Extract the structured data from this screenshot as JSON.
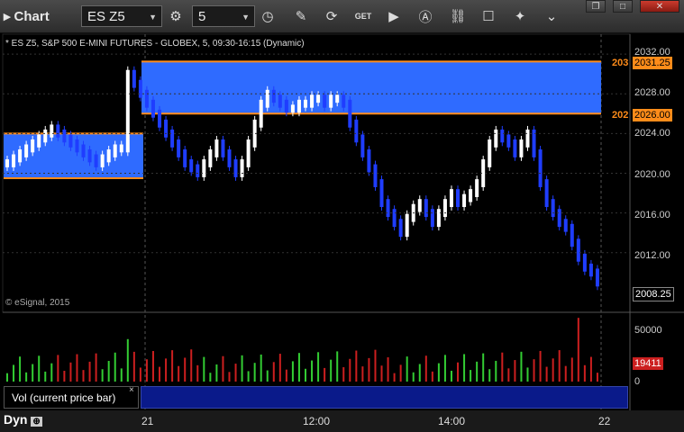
{
  "app": {
    "title": "Chart"
  },
  "toolbar": {
    "symbol": "ES Z5",
    "interval": "5",
    "icons": [
      "settings-icon",
      "clock-icon",
      "pencil-icon",
      "refresh-icon",
      "get-icon",
      "play-icon",
      "alert-icon",
      "link-icon",
      "comment-icon",
      "twitter-icon",
      "down-icon"
    ]
  },
  "window_buttons": {
    "restore": "❐",
    "maximize": "□",
    "close": "✕"
  },
  "chart": {
    "subtitle": "* ES Z5, S&P 500 E-MINI FUTURES - GLOBEX, 5, 09:30-16:15 (Dynamic)",
    "copyright": "© eSignal, 2015",
    "price_labels": [
      "2032.00",
      "2028.00",
      "2024.00",
      "2020.00",
      "2016.00",
      "2012.00"
    ],
    "current_price": "2008.25",
    "level_high_price": "2031.25",
    "level_low_price": "2026.00",
    "level_high_prefix": "203",
    "level_low_prefix": "202",
    "volume_labels": [
      "50000",
      "0"
    ],
    "current_volume": "19411",
    "volume_panel_label": "Vol (current price bar)",
    "time_labels": [
      "21",
      "12:00",
      "14:00",
      "22"
    ],
    "colors": {
      "up": "#ffffff",
      "down": "#1f3dff",
      "zone": "#2f6bff",
      "level": "#ff8c1a",
      "vol_up": "#33cc33",
      "vol_down": "#cc1f1f"
    }
  },
  "chart_data": {
    "type": "candlestick",
    "price_ylim": [
      2006,
      2034
    ],
    "volume_ylim": [
      0,
      60000
    ],
    "zones": [
      {
        "from_price": 2019.5,
        "to_price": 2024.0,
        "session": "previous"
      },
      {
        "from_price": 2026.0,
        "to_price": 2031.25,
        "session": "current"
      }
    ],
    "volume_last": 19411
  },
  "status": {
    "mode": "Dyn"
  }
}
